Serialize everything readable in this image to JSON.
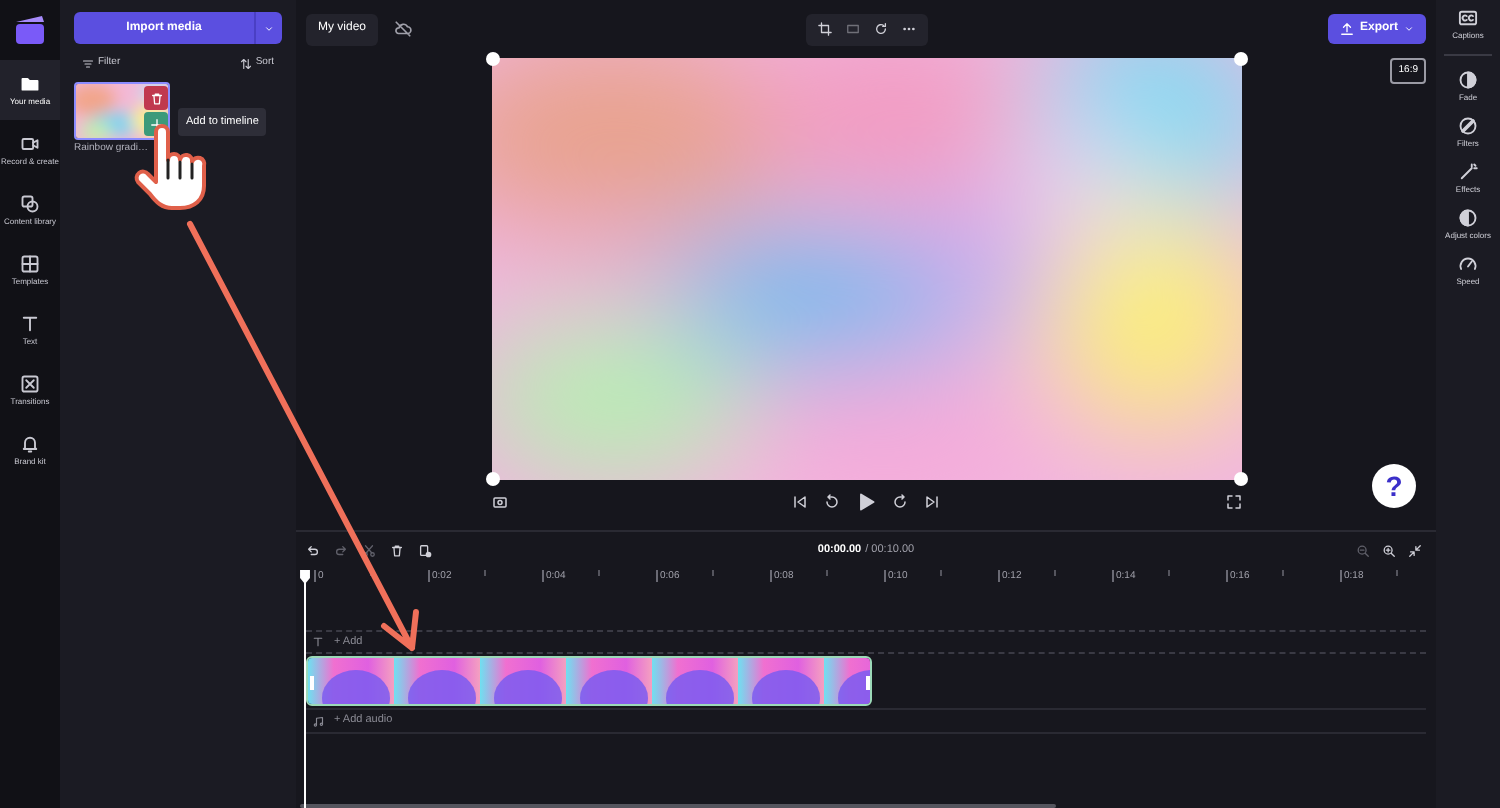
{
  "nav": [
    {
      "label": "Your media",
      "selected": true
    },
    {
      "label": "Record & create",
      "selected": false
    },
    {
      "label": "Content library",
      "selected": false
    },
    {
      "label": "Templates",
      "selected": false
    },
    {
      "label": "Text",
      "selected": false
    },
    {
      "label": "Transitions",
      "selected": false
    },
    {
      "label": "Brand kit",
      "selected": false
    }
  ],
  "media_panel": {
    "import_button": "Import media",
    "filter": "Filter",
    "sort": "Sort",
    "items": [
      {
        "name": "Rainbow gradi…"
      }
    ],
    "tooltip": "Add to timeline"
  },
  "project_title": "My video",
  "export_button": "Export",
  "aspect_ratio": "16:9",
  "right_panel": [
    {
      "label": "Captions"
    },
    {
      "label": "Fade"
    },
    {
      "label": "Filters"
    },
    {
      "label": "Effects"
    },
    {
      "label": "Adjust colors"
    },
    {
      "label": "Speed"
    }
  ],
  "help_button": "?",
  "timeline": {
    "current_time": "00:00.00",
    "duration": "/ 00:10.00",
    "ticks": [
      "0",
      "0:02",
      "0:04",
      "0:06",
      "0:08",
      "0:10",
      "0:12",
      "0:14",
      "0:16",
      "0:18"
    ],
    "text_track": "+ Add",
    "audio_track": "+ Add audio"
  }
}
